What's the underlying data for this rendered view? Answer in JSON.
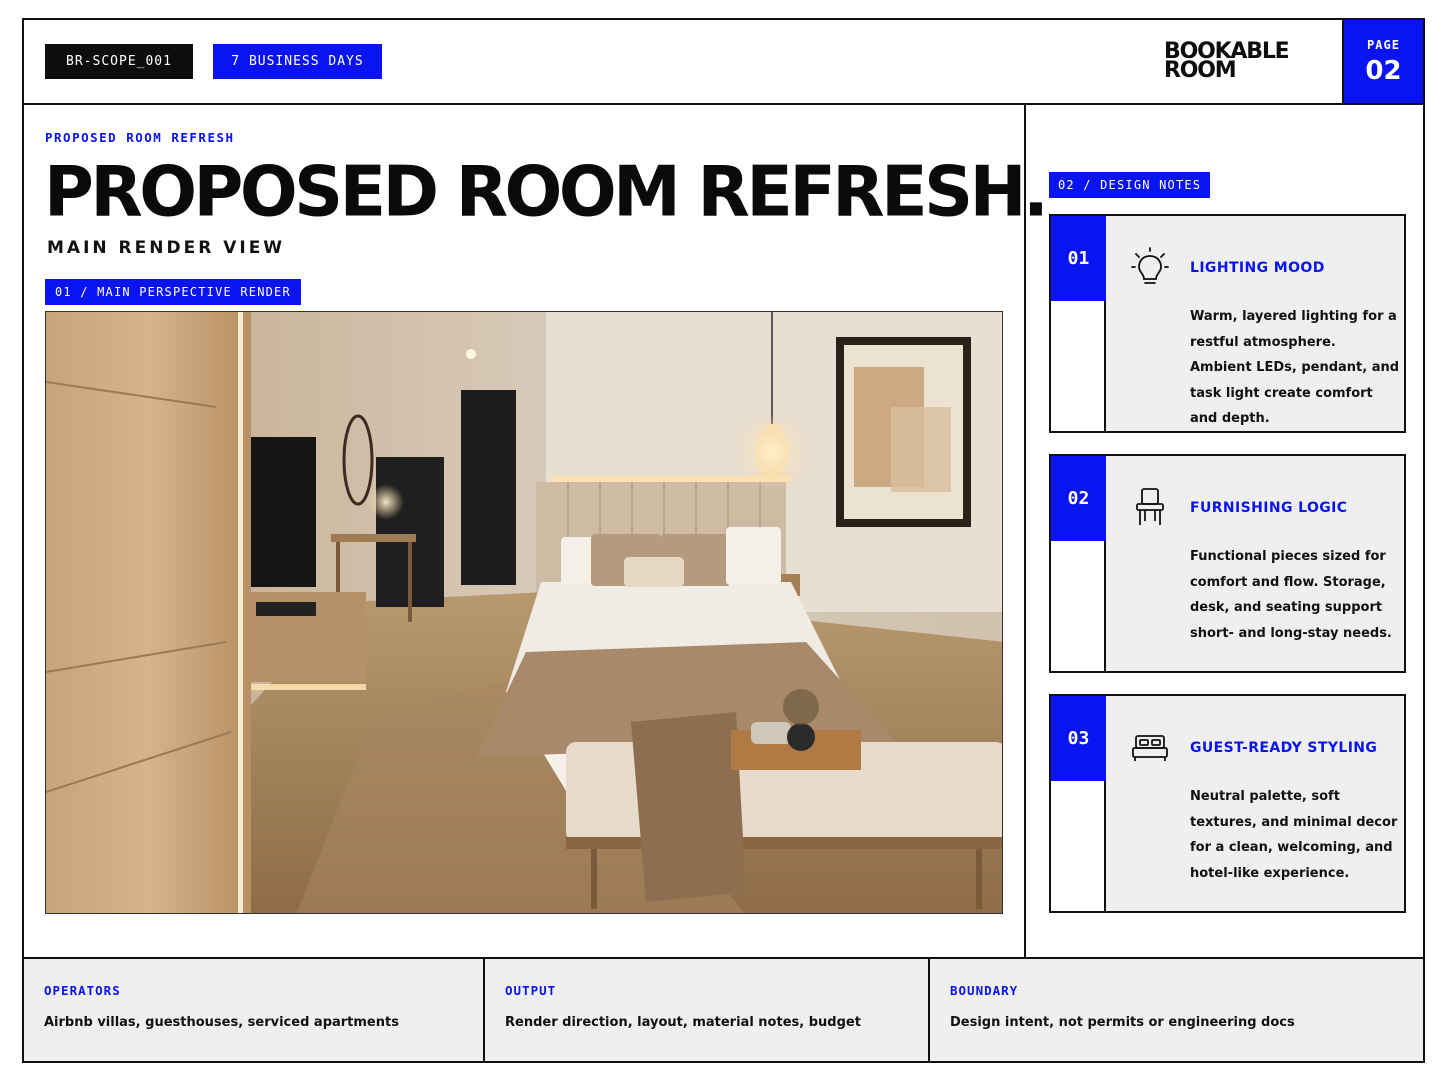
{
  "header": {
    "doc_id": "BR-SCOPE_001",
    "timeline": "7 BUSINESS DAYS",
    "brand_line1": "BOOKABLE",
    "brand_line2": "ROOM",
    "page_label": "PAGE",
    "page_number": "02"
  },
  "main": {
    "kicker": "PROPOSED ROOM REFRESH",
    "title": "PROPOSED ROOM REFRESH.",
    "subtitle": "MAIN RENDER VIEW",
    "render_tag": "01 / MAIN PERSPECTIVE RENDER"
  },
  "notes": {
    "tag": "02 / DESIGN NOTES",
    "items": [
      {
        "number": "01",
        "icon": "lightbulb-icon",
        "title": "LIGHTING MOOD",
        "body": "Warm, layered lighting for a restful atmosphere. Ambient LEDs, pendant, and task light create comfort and depth."
      },
      {
        "number": "02",
        "icon": "chair-icon",
        "title": "FURNISHING LOGIC",
        "body": "Functional pieces sized for comfort and flow. Storage, desk, and seating support short- and long-stay needs."
      },
      {
        "number": "03",
        "icon": "bed-icon",
        "title": "GUEST-READY STYLING",
        "body": "Neutral palette, soft textures, and minimal decor for a clean, welcoming, and hotel-like experience."
      }
    ]
  },
  "footer": {
    "cells": [
      {
        "label": "OPERATORS",
        "text": "Airbnb villas, guesthouses, serviced apartments"
      },
      {
        "label": "OUTPUT",
        "text": "Render direction, layout, material notes, budget"
      },
      {
        "label": "BOUNDARY",
        "text": "Design intent, not permits or engineering docs"
      }
    ]
  },
  "colors": {
    "accent": "#0a14f0",
    "ink": "#0d0d0d",
    "panel": "#efefef"
  }
}
